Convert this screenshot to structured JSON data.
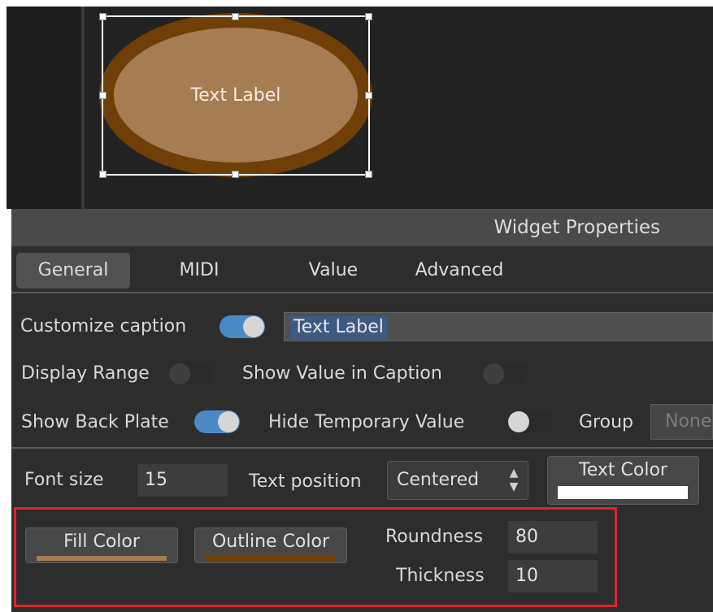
{
  "canvas": {
    "widget_caption": "Text Label",
    "fill_color": "#a67c52",
    "outline_color": "#6f3f07"
  },
  "panel": {
    "title": "Widget Properties",
    "tabs": [
      {
        "label": "General",
        "active": true
      },
      {
        "label": "MIDI",
        "active": false
      },
      {
        "label": "Value",
        "active": false
      },
      {
        "label": "Advanced",
        "active": false
      }
    ]
  },
  "general": {
    "customize_caption": {
      "label": "Customize caption",
      "on": true
    },
    "caption_value": "Text Label",
    "display_range": {
      "label": "Display Range",
      "on": false
    },
    "show_value_in_caption": {
      "label": "Show Value in Caption",
      "on": false
    },
    "show_back_plate": {
      "label": "Show Back Plate",
      "on": true
    },
    "hide_temporary_value": {
      "label": "Hide Temporary Value",
      "on": false
    },
    "group": {
      "label": "Group",
      "value": "None"
    },
    "font_size": {
      "label": "Font size",
      "value": "15"
    },
    "text_position": {
      "label": "Text position",
      "value": "Centered"
    },
    "text_color": {
      "label": "Text Color",
      "color": "#ffffff"
    },
    "fill_color": {
      "label": "Fill Color",
      "color": "#a67c52"
    },
    "outline_color": {
      "label": "Outline Color",
      "color": "#6f3f07"
    },
    "roundness": {
      "label": "Roundness",
      "value": "80"
    },
    "thickness": {
      "label": "Thickness",
      "value": "10"
    }
  },
  "accent_colors": {
    "toggle_on": "#4b89c4",
    "highlight": "#e0242c"
  },
  "icons": {
    "select_arrows": "up-down-arrows-icon"
  }
}
